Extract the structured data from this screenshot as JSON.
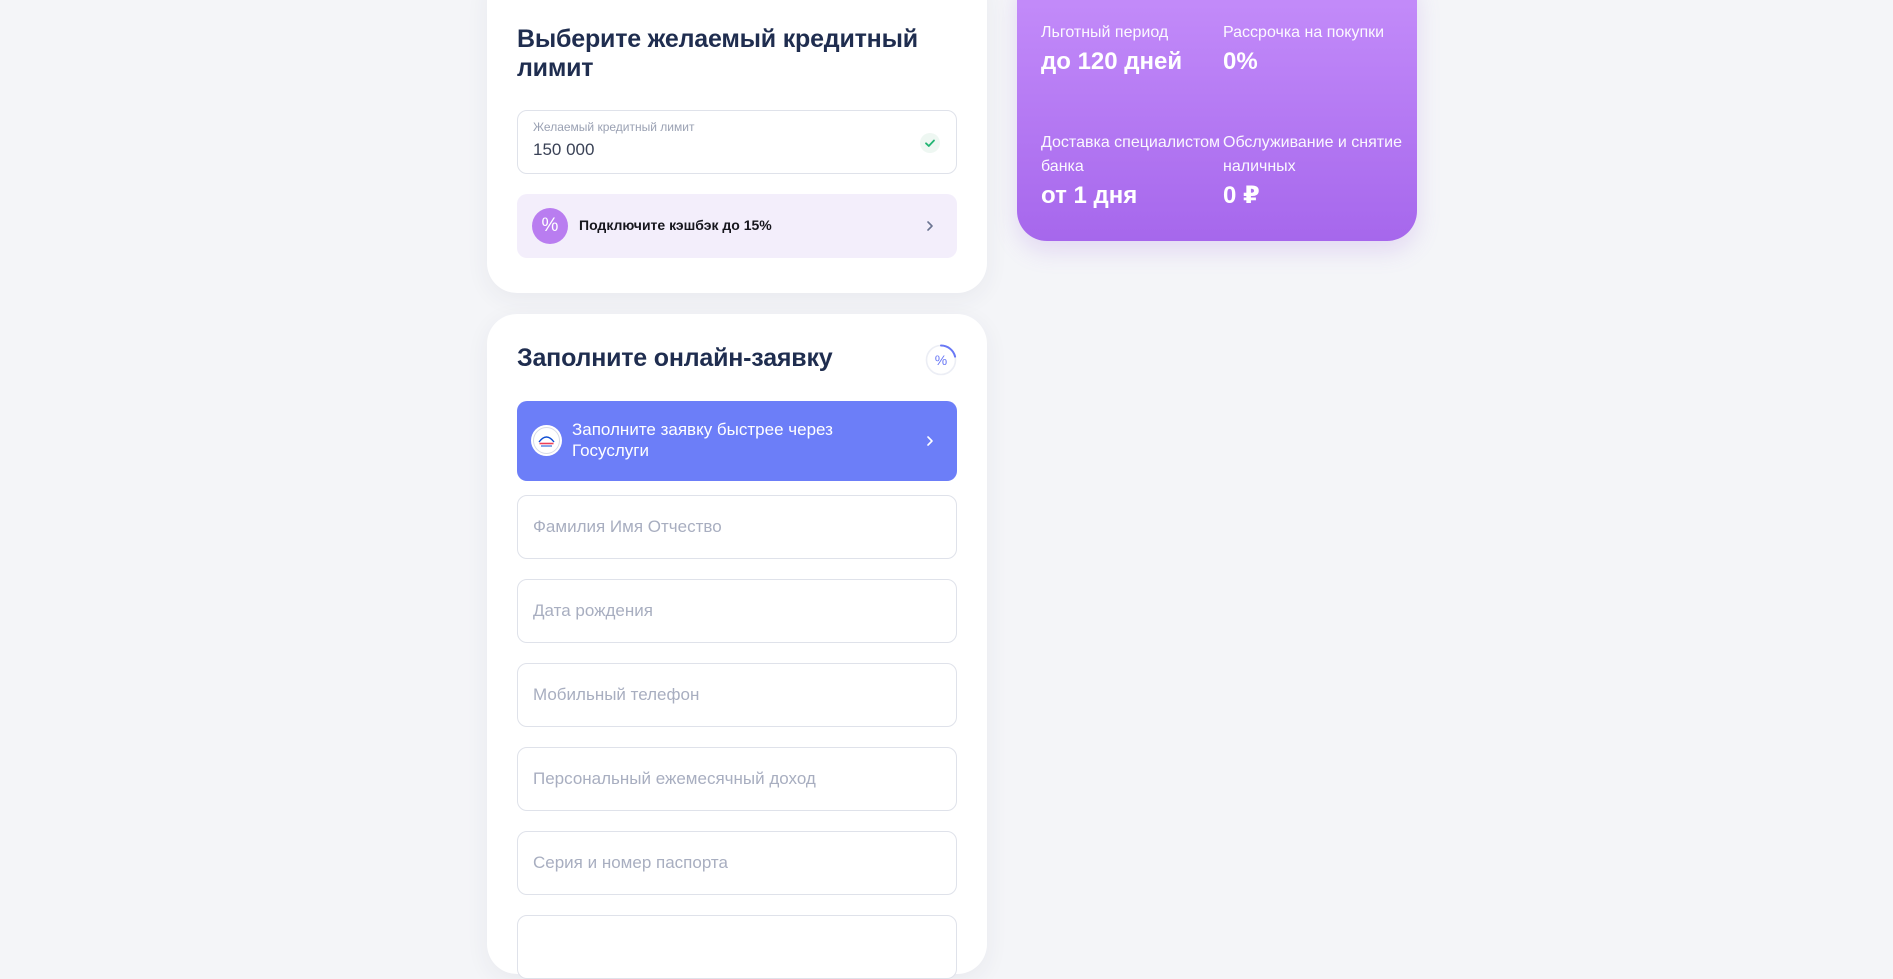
{
  "limit_card": {
    "title": "Выберите желаемый кредитный лимит",
    "limit_field": {
      "label": "Желаемый кредитный лимит",
      "value": "150 000"
    },
    "cashback": {
      "label": "Подключите кэшбэк до 15%",
      "icon": "percent-icon"
    }
  },
  "benefits": {
    "grace": {
      "label": "Льготный период",
      "value": "до 120 дней"
    },
    "installment": {
      "label": "Рассрочка на покупки",
      "value": "0%"
    },
    "delivery": {
      "label": "Доставка специалистом банка",
      "value": "от 1 дня"
    },
    "service": {
      "label": "Обслуживание и снятие наличных",
      "value": "0 ₽"
    }
  },
  "application": {
    "title": "Заполните онлайн-заявку",
    "progress_symbol": "%",
    "gosuslugi_button": "Заполните заявку быстрее через Госуслуги",
    "fields": {
      "full_name": "Фамилия Имя Отчество",
      "birth_date": "Дата рождения",
      "mobile_phone": "Мобильный телефон",
      "monthly_income": "Персональный ежемесячный доход",
      "passport": "Серия и номер паспорта"
    }
  },
  "colors": {
    "accent_blue": "#6c7ef8",
    "accent_purple": "#b97df0",
    "title_text": "#1f2d4f",
    "page_bg": "#f4f5f8"
  }
}
